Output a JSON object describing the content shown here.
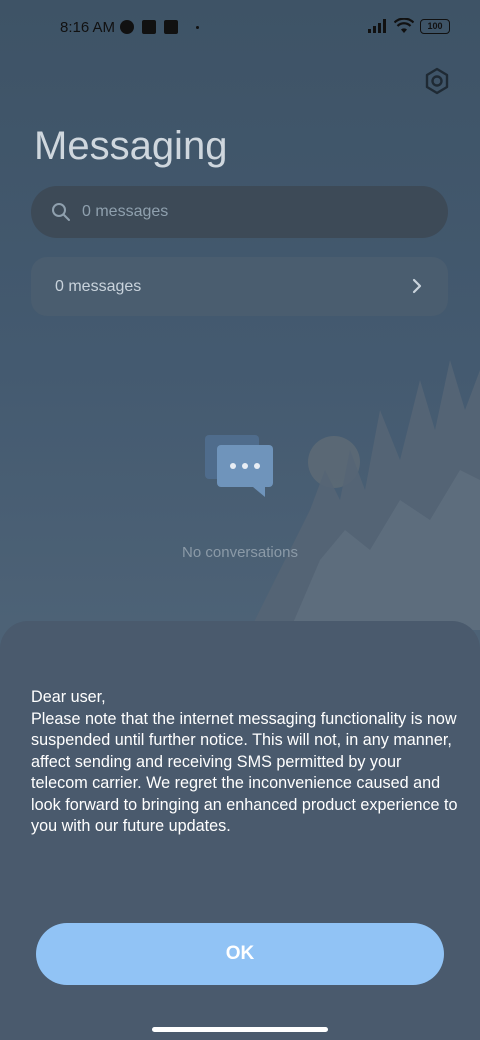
{
  "status_bar": {
    "time": "8:16 AM",
    "battery": "100"
  },
  "header": {
    "title": "Messaging",
    "settings_icon": "gear-icon"
  },
  "search": {
    "placeholder": "0 messages",
    "icon": "search-icon"
  },
  "summary_row": {
    "label": "0 messages",
    "icon": "chevron-right-icon"
  },
  "empty_state": {
    "text": "No conversations",
    "icon": "chat-bubbles-icon"
  },
  "dialog": {
    "message": "Dear user,\nPlease note that the internet messaging functionality is now suspended until further notice. This will not, in any manner, affect sending and receiving SMS permitted by your telecom carrier. We regret the inconvenience caused and look forward to bringing an enhanced product experience to you with our future updates.",
    "ok_label": "OK"
  },
  "colors": {
    "accent": "#91c3f5",
    "sheet": "#4a5a6d",
    "background": "#445a70"
  }
}
